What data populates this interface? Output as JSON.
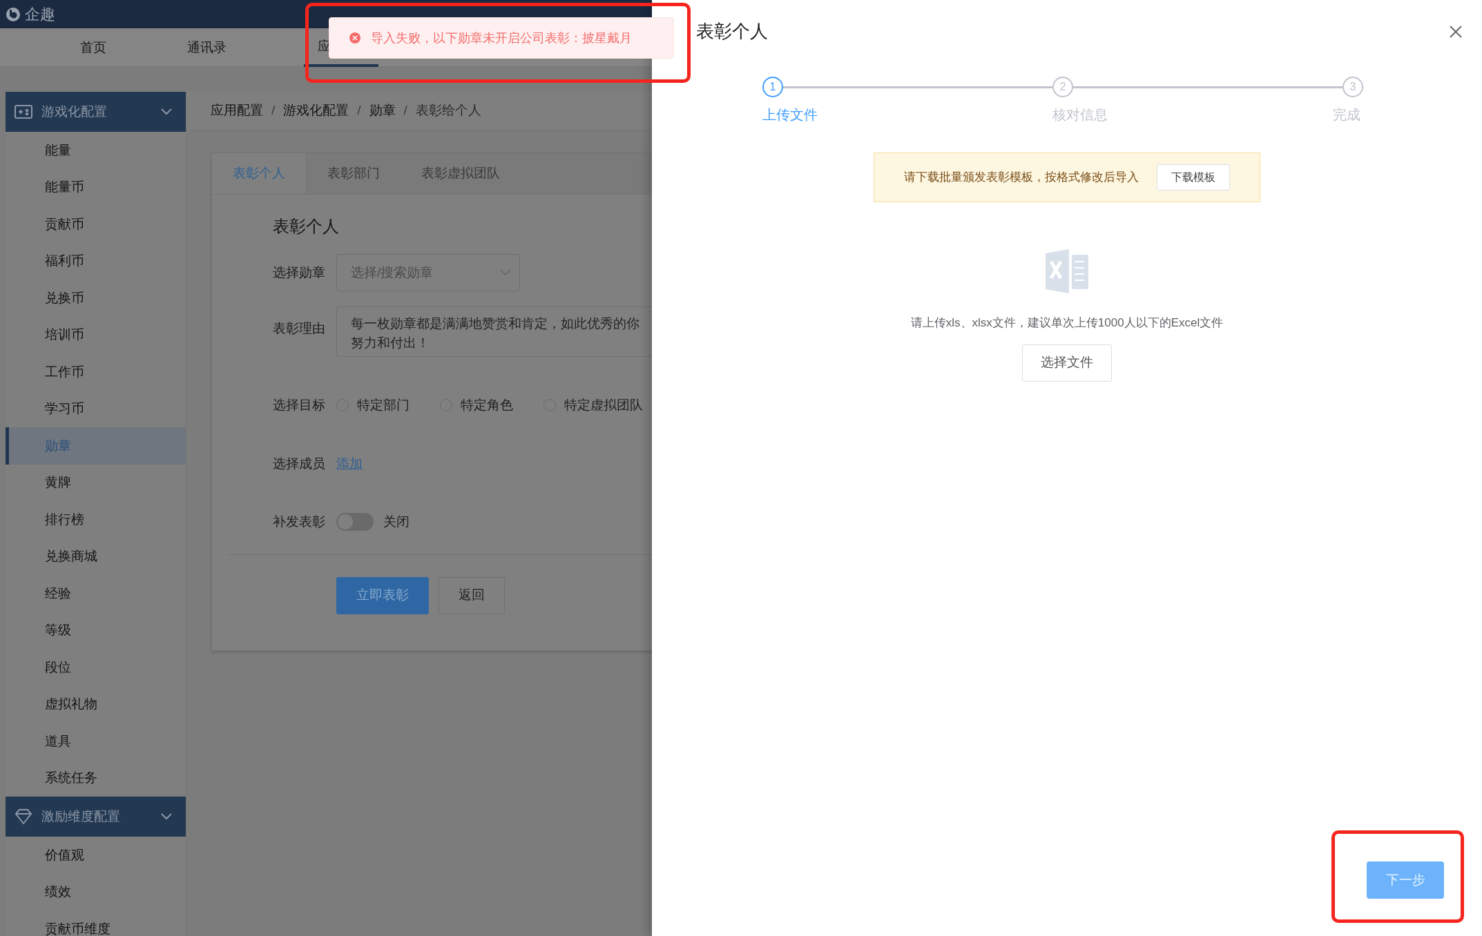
{
  "app": {
    "logo": "企趣"
  },
  "top_nav": [
    {
      "label": "首页",
      "selected": false
    },
    {
      "label": "通讯录",
      "selected": false
    },
    {
      "label": "应",
      "selected": true
    }
  ],
  "sidebar": [
    {
      "label": "游戏化配置",
      "expanded": true,
      "children": [
        {
          "label": "能量",
          "selected": false
        },
        {
          "label": "能量币",
          "selected": false
        },
        {
          "label": "贡献币",
          "selected": false
        },
        {
          "label": "福利币",
          "selected": false
        },
        {
          "label": "兑换币",
          "selected": false
        },
        {
          "label": "培训币",
          "selected": false
        },
        {
          "label": "工作币",
          "selected": false
        },
        {
          "label": "学习币",
          "selected": false
        },
        {
          "label": "勋章",
          "selected": true
        },
        {
          "label": "黄牌",
          "selected": false
        },
        {
          "label": "排行榜",
          "selected": false
        },
        {
          "label": "兑换商城",
          "selected": false
        },
        {
          "label": "经验",
          "selected": false
        },
        {
          "label": "等级",
          "selected": false
        },
        {
          "label": "段位",
          "selected": false
        },
        {
          "label": "虚拟礼物",
          "selected": false
        },
        {
          "label": "道具",
          "selected": false
        },
        {
          "label": "系统任务",
          "selected": false
        }
      ]
    },
    {
      "label": "激励维度配置",
      "expanded": true,
      "children": [
        {
          "label": "价值观",
          "selected": false
        },
        {
          "label": "绩效",
          "selected": false
        },
        {
          "label": "贡献币维度",
          "selected": false
        }
      ]
    }
  ],
  "breadcrumb": {
    "separator": "/",
    "items": [
      "应用配置",
      "游戏化配置",
      "勋章",
      "表彰给个人"
    ]
  },
  "tabs": [
    {
      "label": "表彰个人",
      "selected": true
    },
    {
      "label": "表彰部门",
      "selected": false
    },
    {
      "label": "表彰虚拟团队",
      "selected": false
    }
  ],
  "form": {
    "title": "表彰个人",
    "fields": [
      {
        "kind": "select",
        "label": "选择勋章",
        "placeholder": "选择/搜索勋章"
      },
      {
        "kind": "textarea",
        "label": "表彰理由",
        "value_lines": [
          "每一枚勋章都是满满地赞赏和肯定，如此优秀的你",
          "努力和付出！"
        ]
      },
      {
        "kind": "radio",
        "label": "选择目标",
        "options": [
          {
            "label": "特定部门",
            "selected": false
          },
          {
            "label": "特定角色",
            "selected": false
          },
          {
            "label": "特定虚拟团队",
            "selected": false
          }
        ]
      },
      {
        "kind": "link",
        "label": "选择成员",
        "link": "添加"
      },
      {
        "kind": "switch",
        "label": "补发表彰",
        "on": false,
        "state_text": "关闭"
      }
    ],
    "buttons": [
      {
        "label": "立即表彰",
        "kind": "primary"
      },
      {
        "label": "返回",
        "kind": "default"
      }
    ]
  },
  "toast": {
    "message": "导入失败，以下勋章未开启公司表彰：披星戴月"
  },
  "drawer": {
    "title": "表彰个人",
    "steps": [
      {
        "number": "1",
        "label": "上传文件",
        "selected": true
      },
      {
        "number": "2",
        "label": "核对信息",
        "selected": false
      },
      {
        "number": "3",
        "label": "完成",
        "selected": false
      }
    ],
    "notice": {
      "text": "请下载批量颁发表彰模板，按格式修改后导入",
      "button": "下载模板"
    },
    "upload": {
      "hint": "请上传xls、xlsx文件，建议单次上传1000人以下的Excel文件",
      "button": "选择文件"
    },
    "next_button": {
      "label": "下一步",
      "disabled": true
    }
  }
}
